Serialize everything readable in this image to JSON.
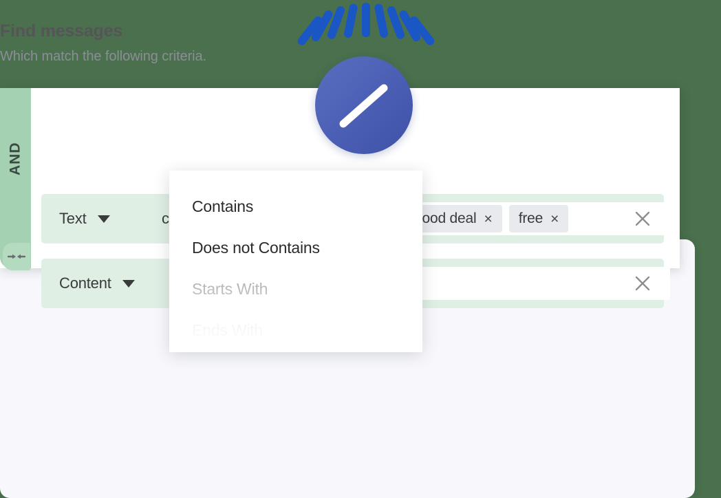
{
  "theme": {
    "background": "#4a704d",
    "card_bg": "#ffffff",
    "lower_panel_bg": "#f8f8fc",
    "row_green": "#e0efe4",
    "rail_green": "#a5d1b3",
    "chip_gray": "#e8eaed",
    "accent_blue": "#1a56c4",
    "cursor_blue": "#4b5fb5"
  },
  "header": {
    "title": "Find messages",
    "subtitle": "Which match the following criteria."
  },
  "group": {
    "operator_label": "AND",
    "collapse_icon": "collapse-arrows-icon"
  },
  "rows": [
    {
      "field": "Text",
      "field_caret": "chevron-down-icon",
      "operator": "contains",
      "operator_caret": "chevron-down-icon",
      "list_icon": "list-bullets-icon",
      "tags": [
        {
          "label": "good deal",
          "remove": "×"
        },
        {
          "label": "free",
          "remove": "×"
        }
      ],
      "delete_icon": "×"
    },
    {
      "field": "Content",
      "field_caret": "chevron-down-icon",
      "value": "",
      "value_placeholder": "",
      "delete_icon": "×"
    }
  ],
  "operator_menu": {
    "items": [
      {
        "label": "Contains",
        "state": "normal"
      },
      {
        "label": "Does not Contains",
        "state": "normal"
      },
      {
        "label": "Starts With",
        "state": "faded"
      },
      {
        "label": "Ends With",
        "state": "more-faded"
      }
    ]
  },
  "cursor": {
    "name": "click-burst-indicator",
    "ray_count": 9
  }
}
